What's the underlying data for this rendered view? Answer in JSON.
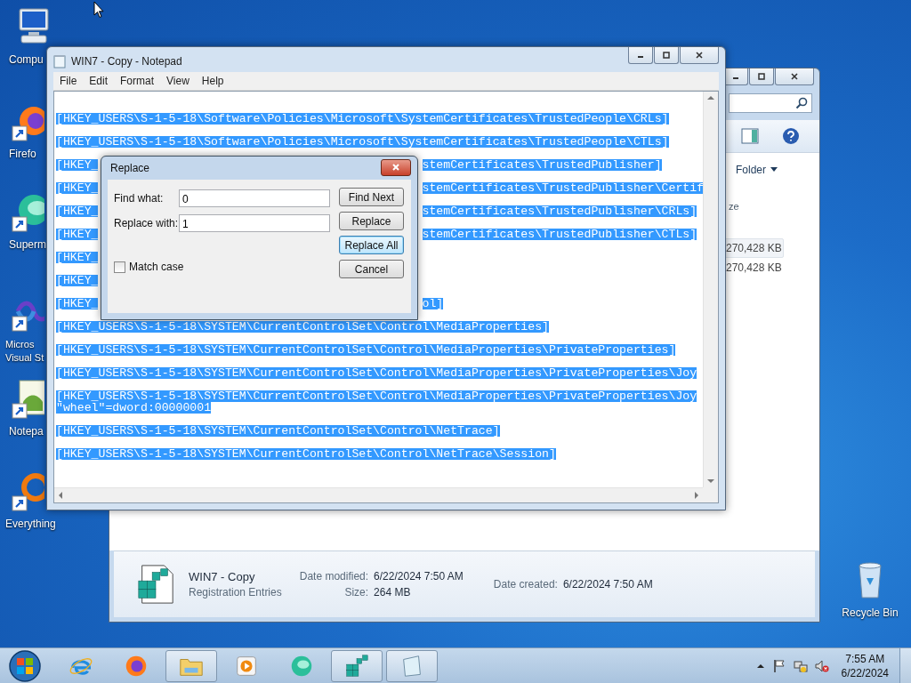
{
  "desktop_icons": [
    {
      "kind": "computer",
      "shortcut": false,
      "lines": [
        "Compu"
      ]
    },
    {
      "kind": "firefox",
      "shortcut": true,
      "lines": [
        "Firefo"
      ]
    },
    {
      "kind": "sphere",
      "shortcut": true,
      "lines": [
        "Superm"
      ]
    },
    {
      "kind": "infinity",
      "shortcut": true,
      "lines": [
        "Micros",
        "Visual St"
      ]
    },
    {
      "kind": "notepad",
      "shortcut": true,
      "lines": [
        "Notepa"
      ]
    },
    {
      "kind": "ring",
      "shortcut": true,
      "lines": [
        "Everything"
      ]
    }
  ],
  "recycle_bin": {
    "label": "Recycle Bin"
  },
  "explorer": {
    "arrange_by": "Folder",
    "column_header": "ze",
    "rows": [
      {
        "size": "270,428 KB",
        "selected": true
      },
      {
        "size": "270,428 KB",
        "selected": false
      }
    ],
    "details": {
      "name": "WIN7 - Copy",
      "type": "Registration Entries",
      "columns": [
        [
          {
            "label": "Date modified:",
            "value": "6/22/2024 7:50 AM"
          },
          {
            "label": "Size:",
            "value": "264 MB"
          }
        ],
        [
          {
            "label": "Date created:",
            "value": "6/22/2024 7:50 AM"
          }
        ]
      ]
    }
  },
  "notepad": {
    "title": "WIN7 - Copy - Notepad",
    "menu": [
      "File",
      "Edit",
      "Format",
      "View",
      "Help"
    ],
    "selected": true,
    "blocks": [
      [
        {
          "parts": [
            "[HKEY_USERS\\S-1-5-18\\Software\\Policies\\Microsoft\\SystemCertificates\\TrustedPeople\\CRLs]"
          ]
        }
      ],
      [
        {
          "parts": [
            "[HKEY_USERS\\S-1-5-18\\Software\\Policies\\Microsoft\\SystemCertificates\\TrustedPeople\\CTLs]"
          ]
        }
      ],
      [
        {
          "parts": [
            "[HKEY_",
            "stemCertificates\\TrustedPublisher]"
          ]
        }
      ],
      [
        {
          "parts": [
            "[HKEY_",
            "stemCertificates\\TrustedPublisher\\Certif"
          ]
        }
      ],
      [
        {
          "parts": [
            "[HKEY_",
            "stemCertificates\\TrustedPublisher\\CRLs]"
          ]
        }
      ],
      [
        {
          "parts": [
            "[HKEY_",
            "stemCertificates\\TrustedPublisher\\CTLs]"
          ]
        }
      ],
      [
        {
          "parts": [
            "[HKEY_"
          ]
        }
      ],
      [
        {
          "parts": [
            "[HKEY_"
          ]
        }
      ],
      [
        {
          "parts": [
            "[HKEY_",
            "ol]"
          ]
        }
      ],
      [
        {
          "parts": [
            "[HKEY_USERS\\S-1-5-18\\SYSTEM\\CurrentControlSet\\Control\\MediaProperties]"
          ]
        }
      ],
      [
        {
          "parts": [
            "[HKEY_USERS\\S-1-5-18\\SYSTEM\\CurrentControlSet\\Control\\MediaProperties\\PrivateProperties]"
          ]
        }
      ],
      [
        {
          "parts": [
            "[HKEY_USERS\\S-1-5-18\\SYSTEM\\CurrentControlSet\\Control\\MediaProperties\\PrivateProperties\\Joy"
          ]
        }
      ],
      [
        {
          "parts": [
            "[HKEY_USERS\\S-1-5-18\\SYSTEM\\CurrentControlSet\\Control\\MediaProperties\\PrivateProperties\\Joy"
          ]
        },
        {
          "parts": [
            "\"wheel\"=dword:00000001"
          ]
        }
      ],
      [
        {
          "parts": [
            "[HKEY_USERS\\S-1-5-18\\SYSTEM\\CurrentControlSet\\Control\\NetTrace]"
          ]
        }
      ],
      [
        {
          "parts": [
            "[HKEY_USERS\\S-1-5-18\\SYSTEM\\CurrentControlSet\\Control\\NetTrace\\Session]"
          ]
        }
      ]
    ]
  },
  "replace_dialog": {
    "title": "Replace",
    "fields": [
      {
        "label": "Find what:",
        "value": "0"
      },
      {
        "label": "Replace with:",
        "value": "1"
      }
    ],
    "buttons": [
      {
        "label": "Find Next",
        "default": false
      },
      {
        "label": "Replace",
        "default": false
      },
      {
        "label": "Replace All",
        "default": true
      },
      {
        "label": "Cancel",
        "default": false
      }
    ],
    "match_case": {
      "label": "Match case",
      "checked": false
    }
  },
  "taskbar": {
    "apps": [
      {
        "kind": "ie",
        "running": false
      },
      {
        "kind": "firefox",
        "running": false
      },
      {
        "kind": "folder",
        "running": true
      },
      {
        "kind": "media",
        "running": false
      },
      {
        "kind": "sphere",
        "running": false
      },
      {
        "kind": "registry",
        "running": true
      },
      {
        "kind": "notepad",
        "running": true
      }
    ],
    "time": "7:55 AM",
    "date": "6/22/2024"
  }
}
